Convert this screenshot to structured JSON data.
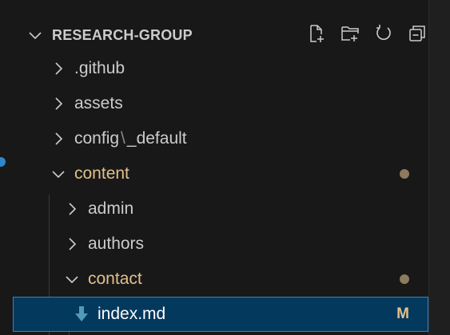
{
  "explorer": {
    "section_title": "RESEARCH-GROUP",
    "actions": {
      "new_file_icon": "new-file-icon",
      "new_folder_icon": "new-folder-icon",
      "refresh_icon": "refresh-icon",
      "collapse_icon": "collapse-all-icon"
    },
    "tree": [
      {
        "label": ".github",
        "expanded": false
      },
      {
        "label": "assets",
        "expanded": false
      },
      {
        "label_part1": "config",
        "separator": "\\",
        "label_part2": "_default",
        "expanded": false
      },
      {
        "label": "content",
        "expanded": true,
        "modified_dot": true
      },
      {
        "label": "admin",
        "expanded": false
      },
      {
        "label": "authors",
        "expanded": false
      },
      {
        "label": "contact",
        "expanded": true,
        "modified_dot": true
      },
      {
        "label": "index.md",
        "badge": "M",
        "selected": true
      }
    ]
  },
  "colors": {
    "background": "#181818",
    "selected_bg": "#04395e",
    "selected_border": "#2f86c9",
    "modified_text": "#e2c08d",
    "text": "#cccccc",
    "markdown_icon": "#519aba"
  }
}
